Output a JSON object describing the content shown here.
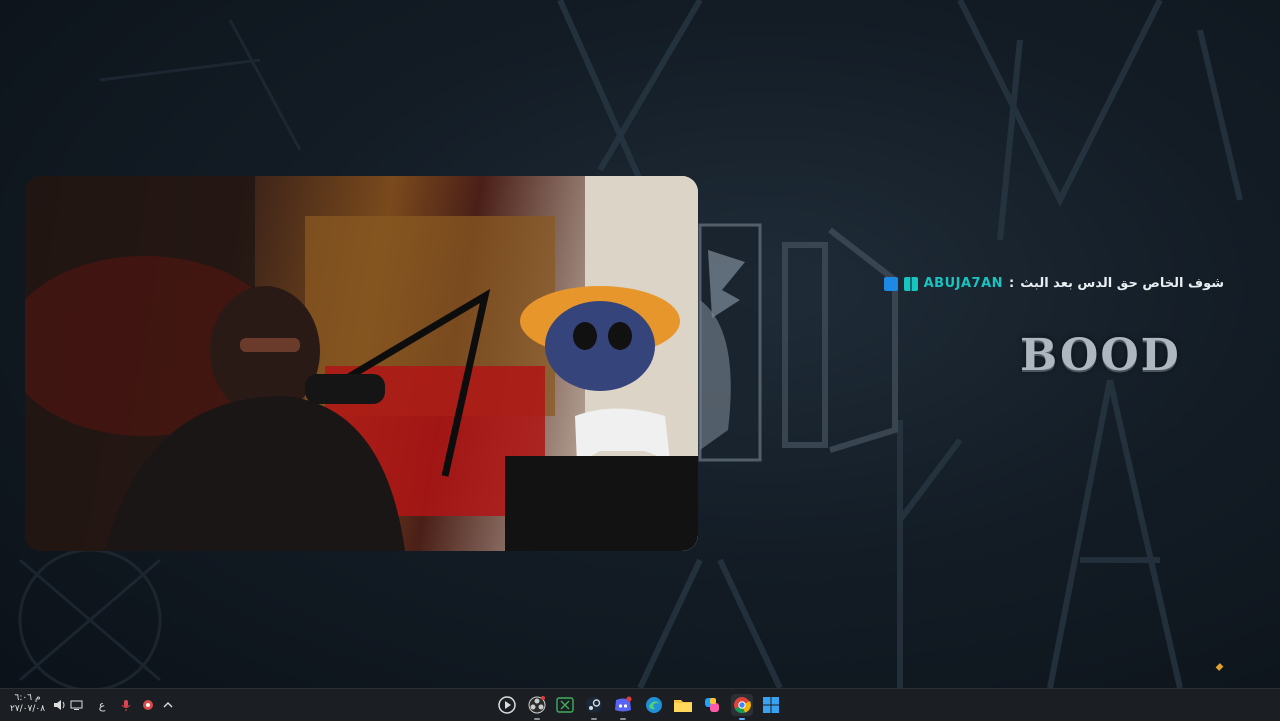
{
  "chat": {
    "username": "ABUJA7AN",
    "separator": ":",
    "message": "شوف الخاص حق الدس بعد البث"
  },
  "brand": {
    "logo_text": "BOOD"
  },
  "taskbar": {
    "clock_time": "م ٦:٠٦",
    "clock_date": "٢٧/٠٧/٠٨",
    "language": "ع",
    "apps": [
      {
        "name": "media-player",
        "icon": "play-circle-icon"
      },
      {
        "name": "obs-studio",
        "icon": "obs-icon"
      },
      {
        "name": "xbox",
        "icon": "xbox-icon"
      },
      {
        "name": "steam",
        "icon": "steam-icon"
      },
      {
        "name": "discord",
        "icon": "discord-icon"
      },
      {
        "name": "edge",
        "icon": "edge-icon"
      },
      {
        "name": "file-explorer",
        "icon": "folder-icon"
      },
      {
        "name": "copilot",
        "icon": "copilot-icon"
      },
      {
        "name": "chrome",
        "icon": "chrome-icon"
      },
      {
        "name": "start",
        "icon": "windows-icon"
      }
    ]
  },
  "colors": {
    "username": "#19c3c0",
    "accent_gold": "#e2a22a",
    "taskbar": "#1b1f24"
  }
}
